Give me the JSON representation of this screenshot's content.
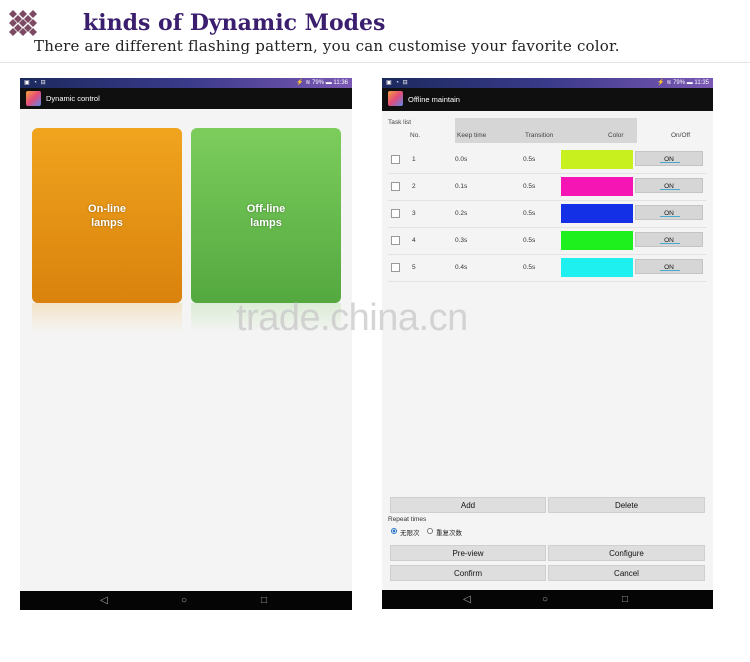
{
  "header": {
    "title": "kinds of Dynamic Modes",
    "subtitle": "There are different flashing pattern, you can customise your favorite color."
  },
  "left_screen": {
    "status": {
      "left_icons": "▣ ◔ ⊟",
      "right": "⚡ ≋ 79% ▬ 11:36"
    },
    "app_title": "Dynamic control",
    "cards": [
      {
        "label": "On-line\nlamps",
        "line1": "On-line",
        "line2": "lamps",
        "color": "#e8931a"
      },
      {
        "label": "Off-line\nlamps",
        "line1": "Off-line",
        "line2": "lamps",
        "color": "#6abf4f"
      }
    ]
  },
  "right_screen": {
    "status": {
      "left_icons": "▣ ◔ ⊟",
      "right": "⚡ ≋ 79% ▬ 11:35"
    },
    "app_title": "Offline maintain",
    "task_list_label": "Task list",
    "columns": {
      "no": "No.",
      "keep": "Keep time",
      "transition": "Transition",
      "color": "Color",
      "onoff": "On/Off"
    },
    "rows": [
      {
        "no": "1",
        "keep": "0.0s",
        "transition": "0.5s",
        "color": "#c8f01e",
        "state": "ON"
      },
      {
        "no": "2",
        "keep": "0.1s",
        "transition": "0.5s",
        "color": "#f514b4",
        "state": "ON"
      },
      {
        "no": "3",
        "keep": "0.2s",
        "transition": "0.5s",
        "color": "#1430e6",
        "state": "ON"
      },
      {
        "no": "4",
        "keep": "0.3s",
        "transition": "0.5s",
        "color": "#1ef01e",
        "state": "ON"
      },
      {
        "no": "5",
        "keep": "0.4s",
        "transition": "0.5s",
        "color": "#1ef0f0",
        "state": "ON"
      }
    ],
    "buttons": {
      "add": "Add",
      "delete": "Delete",
      "preview": "Pre-view",
      "configure": "Configure",
      "confirm": "Confirm",
      "cancel": "Cancel"
    },
    "repeat": {
      "label": "Repeat times",
      "opt_infinite": "无限次",
      "opt_count": "重复次数",
      "selected": "无限次"
    }
  },
  "navbar": {
    "back": "◁",
    "home": "○",
    "recent": "□"
  },
  "watermark": "trade.china.cn",
  "icons": {
    "header_logo": "diamond-grid-icon"
  }
}
